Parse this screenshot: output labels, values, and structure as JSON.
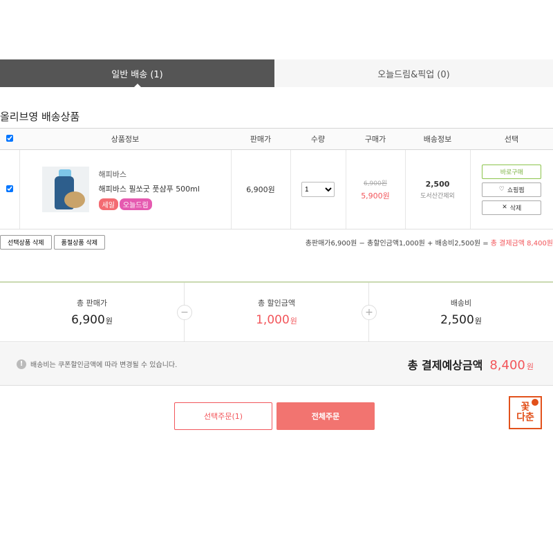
{
  "tabs": [
    {
      "label": "일반 배송 (1)",
      "active": true
    },
    {
      "label": "오늘드림&픽업 (0)",
      "active": false
    }
  ],
  "section_title": "올리브영 배송상품",
  "table": {
    "headers": [
      "상품정보",
      "판매가",
      "수량",
      "구매가",
      "배송정보",
      "선택"
    ],
    "rows": [
      {
        "checked": true,
        "brand": "해피바스",
        "product_name": "해피바스 필쏘굿 풋샴푸 500ml",
        "badges": [
          "세일",
          "오늘드림"
        ],
        "sale_price": "6,900원",
        "quantity": "1",
        "original_price": "6,900원",
        "purchase_price": "5,900원",
        "shipping_fee": "2,500",
        "shipping_note": "도서산간제외",
        "actions": {
          "buy_now": "바로구매",
          "wishlist": "쇼핑찜",
          "delete": "삭제"
        }
      }
    ]
  },
  "bar": {
    "delete_selected": "선택상품 삭제",
    "delete_soldout": "품절상품 삭제",
    "calc_text": "총판매가6,900원 − 총할인금액1,000원 + 배송비2,500원 =",
    "total_label": "총 결제금액",
    "total_amount": "8,400원"
  },
  "summary": {
    "total_price_label": "총 판매가",
    "total_price": "6,900",
    "discount_label": "총 할인금액",
    "discount": "1,000",
    "shipping_label": "배송비",
    "shipping": "2,500",
    "won": "원",
    "minus": "−",
    "plus": "+"
  },
  "notice": {
    "text": "배송비는 쿠폰할인금액에 따라 변경될 수 있습니다.",
    "total_label": "총 결제예상금액",
    "total_value": "8,400",
    "won": "원"
  },
  "buttons": {
    "order_selected": "선택주문(1)",
    "order_all": "전체주문"
  },
  "logo": {
    "line1": "꽃",
    "line2": "다춘"
  },
  "colors": {
    "accent": "#f2555a",
    "tab_active": "#555555",
    "buy_green": "#7cb342"
  }
}
